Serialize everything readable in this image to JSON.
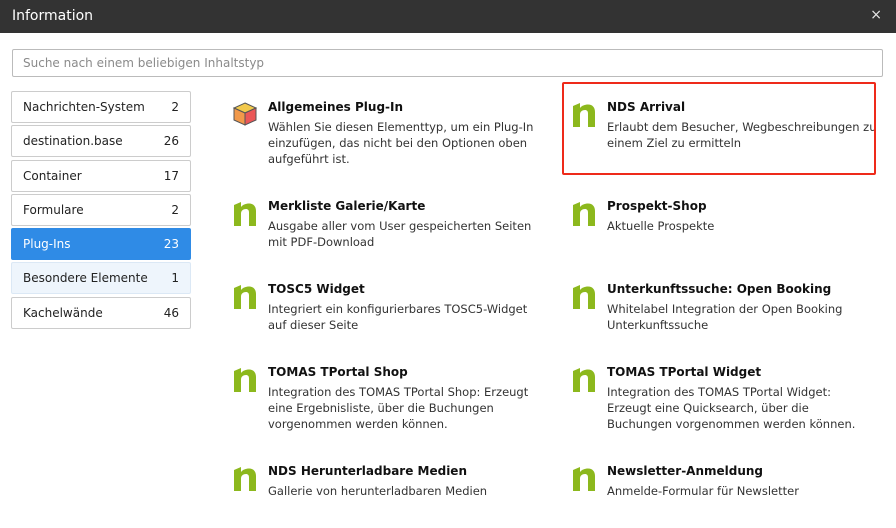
{
  "dialog": {
    "title": "Information",
    "close": "×"
  },
  "search": {
    "placeholder": "Suche nach einem beliebigen Inhaltstyp"
  },
  "categories": [
    {
      "label": "Nachrichten-System",
      "count": "2"
    },
    {
      "label": "destination.base",
      "count": "26"
    },
    {
      "label": "Container",
      "count": "17"
    },
    {
      "label": "Formulare",
      "count": "2"
    },
    {
      "label": "Plug-Ins",
      "count": "23"
    },
    {
      "label": "Besondere Elemente",
      "count": "1"
    },
    {
      "label": "Kachelwände",
      "count": "46"
    }
  ],
  "active_category": "Plug-Ins",
  "colors": {
    "accent": "#2f8be6",
    "logo_green": "#8cb81d",
    "highlight": "#ee2a1a",
    "header": "#333333"
  },
  "elements": [
    {
      "name": "Allgemeines Plug-In",
      "desc": "Wählen Sie diesen Elementtyp, um ein Plug-In einzufügen, das nicht bei den Optionen oben aufgeführt ist.",
      "icon": "cube-icon"
    },
    {
      "name": "NDS Arrival",
      "desc": "Erlaubt dem Besucher, Wegbeschreibungen zu einem Ziel zu ermitteln",
      "icon": "nds-logo-icon"
    },
    {
      "name": "Merkliste Galerie/Karte",
      "desc": "Ausgabe aller vom User gespeicherten Seiten mit PDF-Download",
      "icon": "nds-logo-icon"
    },
    {
      "name": "Prospekt-Shop",
      "desc": "Aktuelle Prospekte",
      "icon": "nds-logo-icon"
    },
    {
      "name": "TOSC5 Widget",
      "desc": "Integriert ein konfigurierbares TOSC5-Widget auf dieser Seite",
      "icon": "nds-logo-icon"
    },
    {
      "name": "Unterkunftssuche: Open Booking",
      "desc": "Whitelabel Integration der Open Booking Unterkunftssuche",
      "icon": "nds-logo-icon"
    },
    {
      "name": "TOMAS TPortal Shop",
      "desc": "Integration des TOMAS TPortal Shop: Erzeugt eine Ergebnisliste, über die Buchungen vorgenommen werden können.",
      "icon": "nds-logo-icon"
    },
    {
      "name": "TOMAS TPortal Widget",
      "desc": "Integration des TOMAS TPortal Widget: Erzeugt eine Quicksearch, über die Buchungen vorgenommen werden können.",
      "icon": "nds-logo-icon"
    },
    {
      "name": "NDS Herunterladbare Medien",
      "desc": "Gallerie von herunterladbaren Medien",
      "icon": "nds-logo-icon"
    },
    {
      "name": "Newsletter-Anmeldung",
      "desc": "Anmelde-Formular für Newsletter",
      "icon": "nds-logo-icon"
    }
  ]
}
